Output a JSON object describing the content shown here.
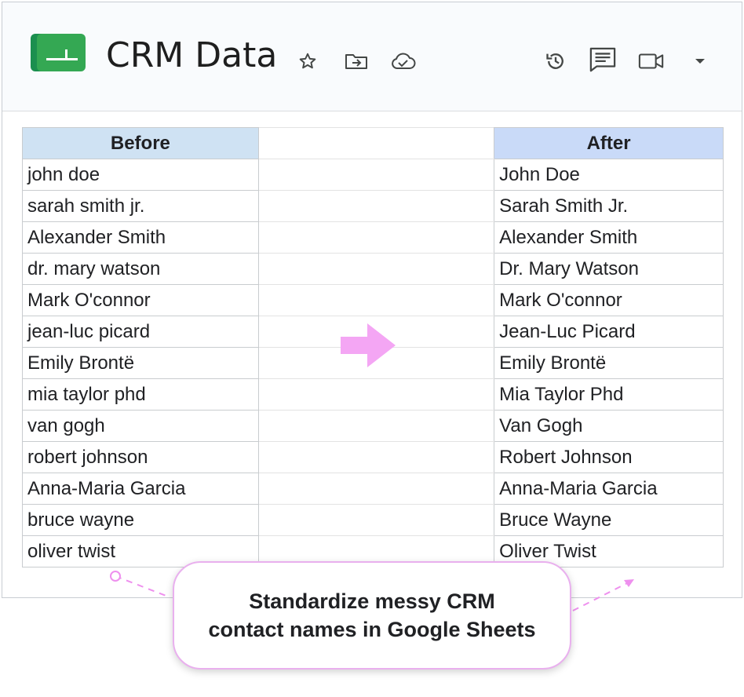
{
  "doc": {
    "title": "CRM Data"
  },
  "toolbar": {
    "icons": [
      "star-icon",
      "move-to-folder-icon",
      "cloud-saved-icon",
      "version-history-icon",
      "comments-icon",
      "meet-video-icon",
      "dropdown-caret-icon"
    ]
  },
  "colors": {
    "logo_green": "#1fa463",
    "before_header_bg": "#cfe2f3",
    "after_header_bg": "#c9daf8",
    "arrow_pink": "#f4a6f4",
    "callout_border": "#e9b0ee"
  },
  "table": {
    "before_header": "Before",
    "after_header": "After",
    "rows": [
      {
        "before": "john doe",
        "after": "John Doe"
      },
      {
        "before": "sarah smith jr.",
        "after": "Sarah Smith Jr."
      },
      {
        "before": "Alexander Smith",
        "after": "Alexander Smith"
      },
      {
        "before": "dr. mary watson",
        "after": "Dr. Mary Watson"
      },
      {
        "before": "Mark O'connor",
        "after": "Mark O'connor"
      },
      {
        "before": "jean-luc picard",
        "after": "Jean-Luc Picard"
      },
      {
        "before": "Emily Brontë",
        "after": "Emily Brontë"
      },
      {
        "before": "mia taylor phd",
        "after": "Mia Taylor Phd"
      },
      {
        "before": "van gogh",
        "after": "Van Gogh"
      },
      {
        "before": "robert johnson",
        "after": "Robert Johnson"
      },
      {
        "before": "Anna-Maria Garcia",
        "after": "Anna-Maria Garcia"
      },
      {
        "before": "bruce wayne",
        "after": "Bruce Wayne"
      },
      {
        "before": "oliver twist",
        "after": "Oliver Twist"
      }
    ]
  },
  "callout": {
    "line1": "Standardize messy CRM",
    "line2": "contact names in Google Sheets"
  }
}
